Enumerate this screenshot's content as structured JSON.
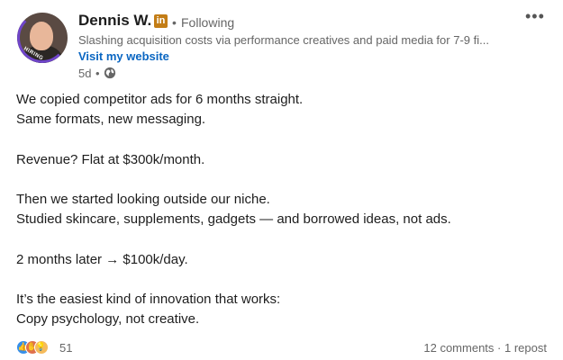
{
  "author": {
    "name": "Dennis W.",
    "badge": "in",
    "connection_sep": "•",
    "connection": "Following",
    "headline": "Slashing acquisition costs via performance creatives and paid media for 7-9 fi...",
    "website_label": "Visit my website",
    "avatar_ring_text": "HIRING",
    "posted_ago": "5d",
    "posted_sep": "•",
    "visibility_icon": "globe-icon"
  },
  "menu": {
    "more_label": "•••"
  },
  "post": {
    "lines": [
      "We copied competitor ads for 6 months straight.",
      "Same formats, new messaging.",
      "",
      "Revenue? Flat at $300k/month.",
      "",
      "Then we started looking outside our niche.",
      "Studied skincare, supplements, gadgets — and borrowed ideas, not ads.",
      "",
      "2 months later → $100k/day.",
      "",
      "It’s the easiest kind of innovation that works:",
      "Copy psychology, not creative."
    ]
  },
  "engagement": {
    "reaction_icons": [
      "like-icon",
      "celebrate-icon",
      "insightful-icon"
    ],
    "reaction_count": "51",
    "comments": "12 comments",
    "sep": "·",
    "reposts": "1 repost"
  },
  "colors": {
    "link": "#0a66c2",
    "muted": "#666666",
    "badge": "#c37d16",
    "ring": "#6f45c9"
  }
}
